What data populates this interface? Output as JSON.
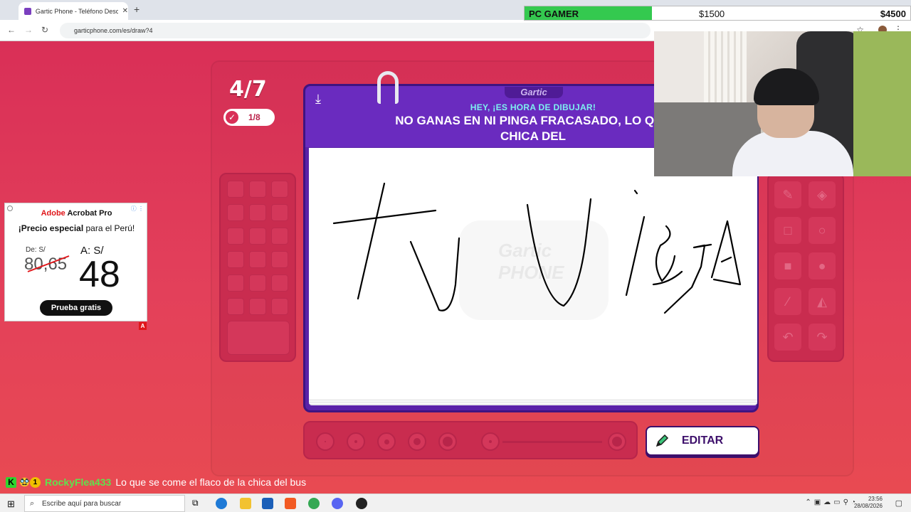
{
  "browser": {
    "tab_title": "Gartic Phone - Teléfono Descon",
    "url": "garticphone.com/es/draw?4"
  },
  "overlay": {
    "goal_name": "PC GAMER",
    "goal_current": "$1500",
    "goal_target": "$4500",
    "goal_progress": 0.33
  },
  "game": {
    "round": "4/7",
    "done_count": "1/8",
    "brand": "Gartic",
    "subtitle": "HEY, ¡ES HORA DE DIBUJAR!",
    "prompt": "NO GANAS EN NI PINGA FRACASADO, LO QUE SE COME EL FLACO DE LA CHICA DEL",
    "prompt_visible_line1": "NO GANAS EN NI PINGA FRACASADO, LO QUE",
    "prompt_visible_line2": "CHICA DEL",
    "watermark_line1": "Gartic",
    "watermark_line2": "PHONE",
    "edit_label": "EDITAR"
  },
  "ad": {
    "brand_red": "Adobe",
    "brand_rest": " Acrobat Pro",
    "headline_pre": "¡Precio especial",
    "headline_post": " para el Perú!",
    "from_label": "De: S/",
    "old_price": "80,65",
    "to_label": "A: S/",
    "new_price": "48",
    "cta": "Prueba gratis",
    "badge": "A"
  },
  "chat": {
    "badge_count": "1",
    "username": "RockyFlea433",
    "message": "Lo que se come el flaco de la chica del bus"
  },
  "taskbar": {
    "search_placeholder": "Escribe aquí para buscar",
    "time": "23:56",
    "date": "28/08/2026"
  },
  "colors": {
    "page_bg": "#e03a56",
    "card_purple": "#6a2bbf",
    "subtitle_cyan": "#7ef0f0",
    "goal_green": "#34c94f"
  }
}
